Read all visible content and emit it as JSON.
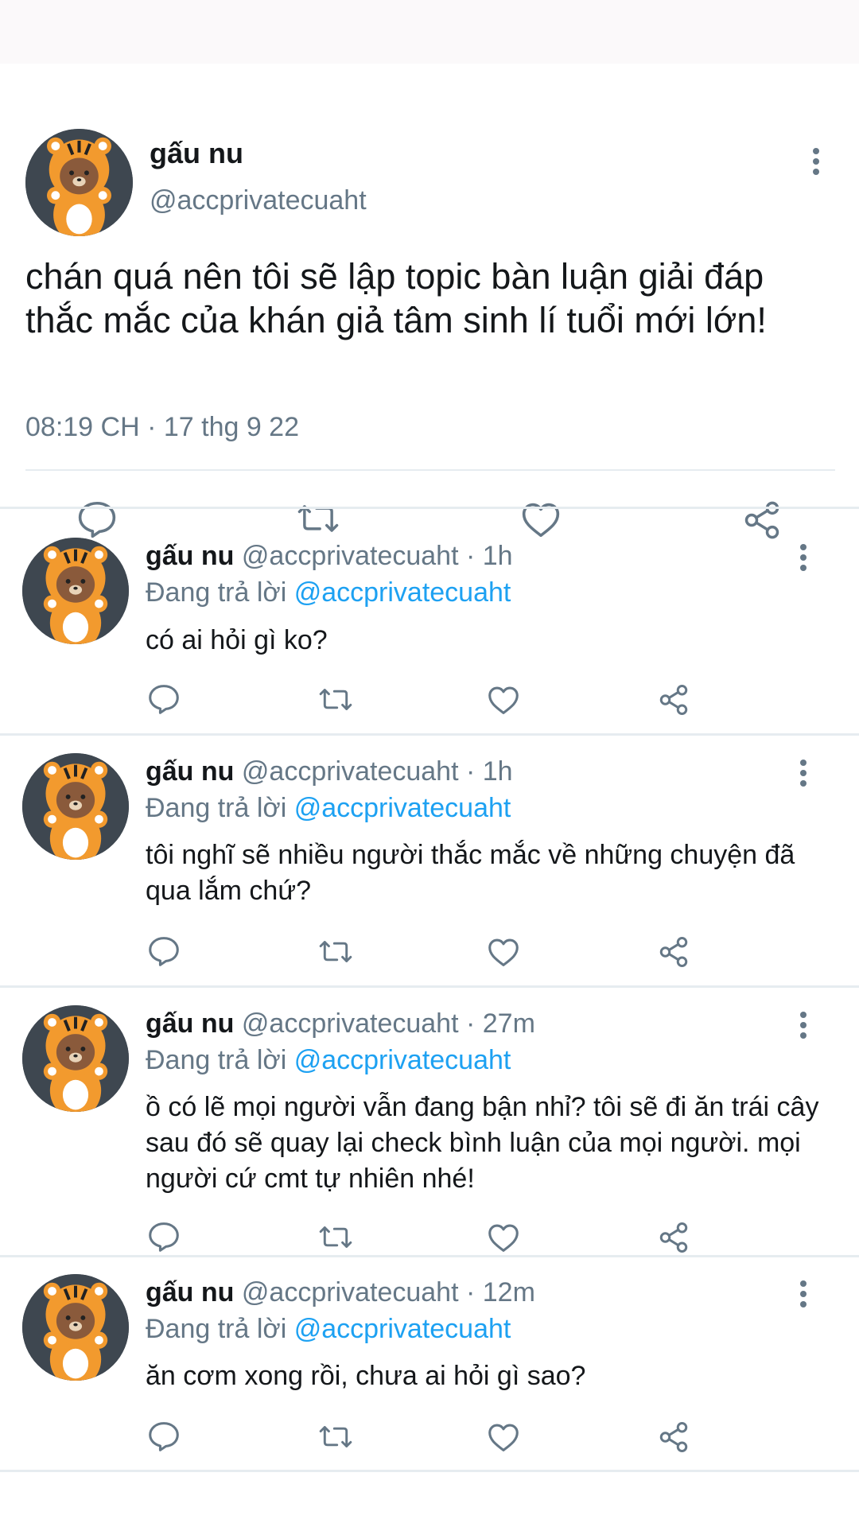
{
  "main_tweet": {
    "display_name": "gấu nu",
    "handle": "@accprivatecuaht",
    "text": "chán quá nên tôi sẽ lập topic bàn luận giải đáp thắc mắc của khán giả tâm sinh lí tuổi mới lớn!",
    "timestamp": "08:19 CH · 17 thg 9 22",
    "actions": [
      "reply-icon",
      "retweet-icon",
      "like-icon",
      "share-icon"
    ]
  },
  "replies": [
    {
      "display_name": "gấu nu",
      "handle_time": "@accprivatecuaht · 1h",
      "replying_prefix": "Đang trả lời ",
      "replying_to": "@accprivatecuaht",
      "text": "có ai hỏi gì ko?"
    },
    {
      "display_name": "gấu nu",
      "handle_time": "@accprivatecuaht · 1h",
      "replying_prefix": "Đang trả lời ",
      "replying_to": "@accprivatecuaht",
      "text": "tôi nghĩ sẽ nhiều người thắc mắc về những chuyện đã qua lắm chứ?"
    },
    {
      "display_name": "gấu nu",
      "handle_time": "@accprivatecuaht · 27m",
      "replying_prefix": "Đang trả lời ",
      "replying_to": "@accprivatecuaht",
      "text": "ồ có lẽ mọi người vẫn đang bận nhỉ? tôi sẽ đi ăn trái cây sau đó sẽ quay lại check bình luận của mọi người. mọi người cứ cmt tự nhiên nhé!"
    },
    {
      "display_name": "gấu nu",
      "handle_time": "@accprivatecuaht · 12m",
      "replying_prefix": "Đang trả lời ",
      "replying_to": "@accprivatecuaht",
      "text": "ăn cơm xong rồi, chưa ai hỏi gì sao?"
    }
  ],
  "colors": {
    "text_primary": "#14171a",
    "text_secondary": "#657786",
    "mention": "#1da1f2",
    "divider": "#e6ecf0",
    "avatar_bg": "#3e4750",
    "tiger_orange": "#f29a2e",
    "bear_brown": "#8a5a3b"
  }
}
